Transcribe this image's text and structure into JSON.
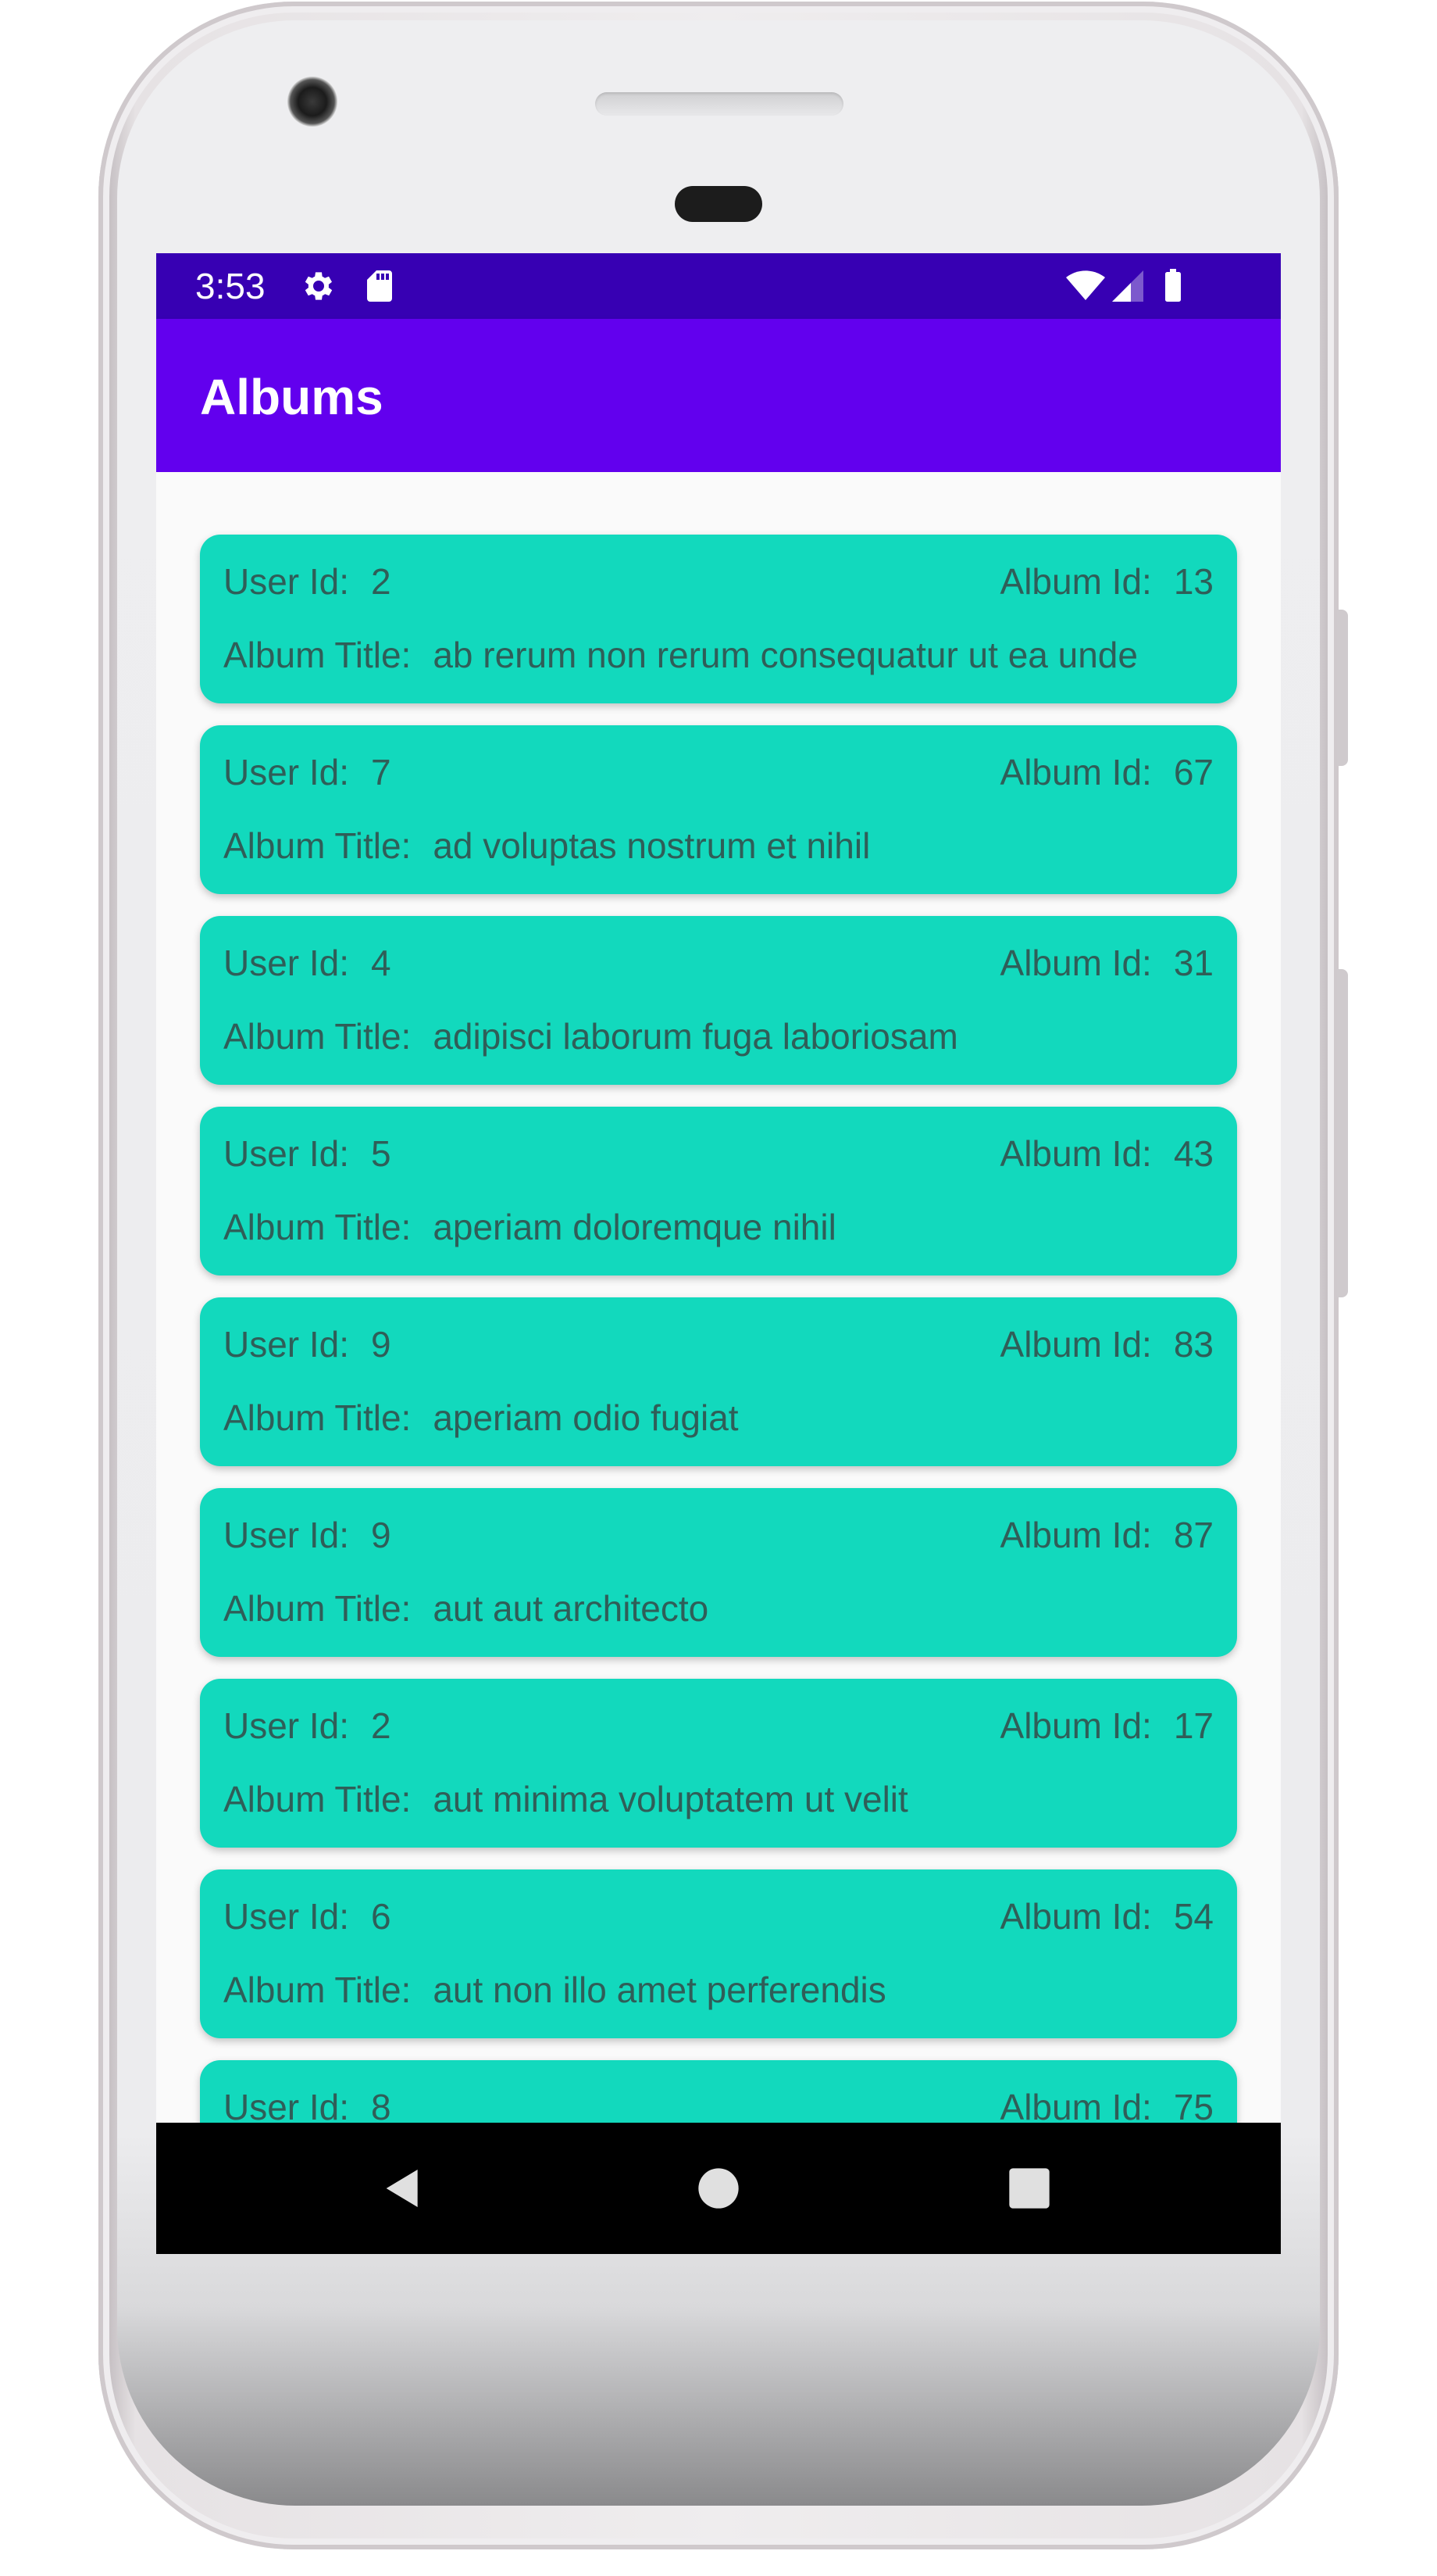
{
  "status_bar": {
    "time": "3:53",
    "icons": [
      "gear-icon",
      "sd-card-icon",
      "wifi-icon",
      "cell-signal-icon",
      "battery-icon"
    ]
  },
  "app_bar": {
    "title": "Albums"
  },
  "labels": {
    "user_id": "User Id:",
    "album_id": "Album Id:",
    "album_title": "Album Title:"
  },
  "albums": [
    {
      "user_id": "2",
      "album_id": "13",
      "title": "ab rerum non rerum consequatur ut ea unde"
    },
    {
      "user_id": "7",
      "album_id": "67",
      "title": "ad voluptas nostrum et nihil"
    },
    {
      "user_id": "4",
      "album_id": "31",
      "title": "adipisci laborum fuga laboriosam"
    },
    {
      "user_id": "5",
      "album_id": "43",
      "title": "aperiam doloremque nihil"
    },
    {
      "user_id": "9",
      "album_id": "83",
      "title": "aperiam odio fugiat"
    },
    {
      "user_id": "9",
      "album_id": "87",
      "title": "aut aut architecto"
    },
    {
      "user_id": "2",
      "album_id": "17",
      "title": "aut minima voluptatem ut velit"
    },
    {
      "user_id": "6",
      "album_id": "54",
      "title": "aut non illo amet perferendis"
    },
    {
      "user_id": "8",
      "album_id": "75",
      "title": ""
    }
  ],
  "nav_bar": {
    "buttons": [
      "back-icon",
      "home-icon",
      "recents-icon"
    ]
  },
  "colors": {
    "status_bar": "#3700b3",
    "app_bar": "#6200ee",
    "card": "#12d9bd",
    "card_text": "#2f5e58",
    "nav_bar": "#000000"
  }
}
